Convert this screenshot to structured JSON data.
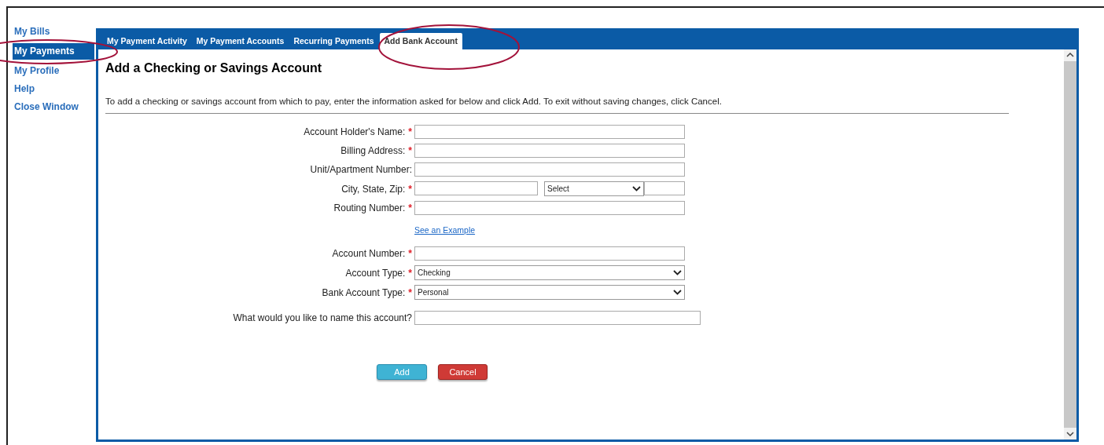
{
  "sidebar": {
    "items": [
      {
        "label": "My Bills",
        "selected": false
      },
      {
        "label": "My Payments",
        "selected": true
      },
      {
        "label": "My Profile",
        "selected": false
      },
      {
        "label": "Help",
        "selected": false
      },
      {
        "label": "Close Window",
        "selected": false
      }
    ]
  },
  "tabs": [
    {
      "label": "My Payment Activity",
      "selected": false
    },
    {
      "label": "My Payment Accounts",
      "selected": false
    },
    {
      "label": "Recurring Payments",
      "selected": false
    },
    {
      "label": "Add Bank Account",
      "selected": true
    }
  ],
  "heading": "Add a Checking or Savings Account",
  "instructions": "To add a checking or savings account from which to pay, enter the information asked for below and click Add. To exit without saving changes, click Cancel.",
  "form": [
    {
      "kind": "text",
      "label": "Account Holder's Name:",
      "required_mark": "*"
    },
    {
      "kind": "text",
      "label": "Billing Address:",
      "required_mark": "*"
    },
    {
      "kind": "text",
      "label": "Unit/Apartment Number:"
    },
    {
      "kind": "city_state_zip",
      "label": "City, State, Zip:",
      "required_mark": "*",
      "value": "Select"
    },
    {
      "kind": "text",
      "label": "Routing Number:",
      "required_mark": "*"
    },
    {
      "kind": "link",
      "label": "See an Example"
    },
    {
      "kind": "text",
      "label": "Account Number:",
      "required_mark": "*"
    },
    {
      "kind": "select",
      "label": "Account Type:",
      "required_mark": "*",
      "value": "Checking"
    },
    {
      "kind": "select",
      "label": "Bank Account Type:",
      "required_mark": "*",
      "value": "Personal"
    },
    {
      "kind": "wide_text",
      "label": "What would you like to name this account?"
    }
  ],
  "buttons": [
    {
      "label": "Add",
      "kind": "primary"
    },
    {
      "label": "Cancel",
      "kind": "danger"
    }
  ]
}
